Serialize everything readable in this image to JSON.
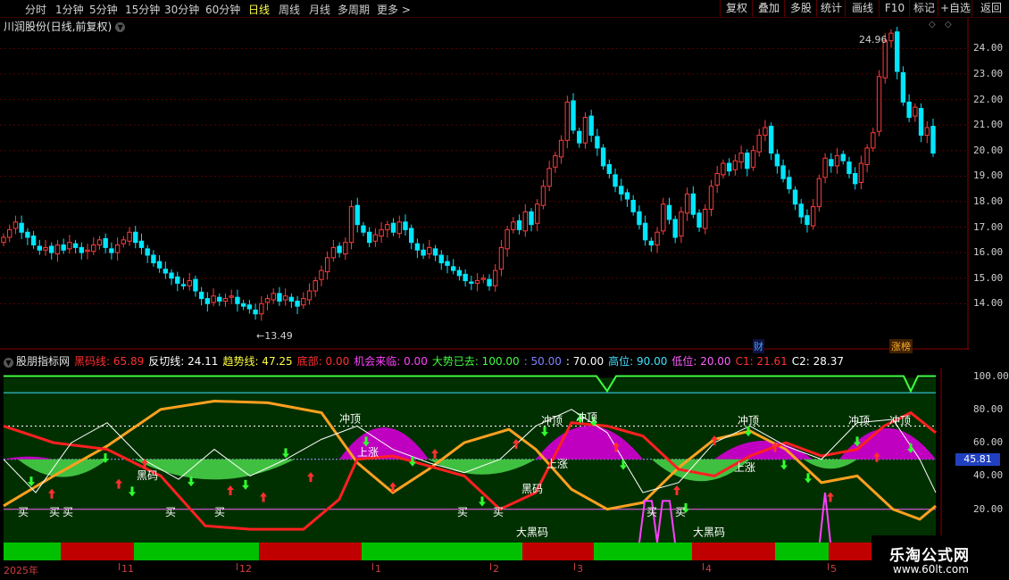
{
  "toolbar": {
    "timeframes": [
      {
        "label": "分时",
        "active": false
      },
      {
        "label": "1分钟",
        "active": false
      },
      {
        "label": "5分钟",
        "active": false
      },
      {
        "label": "15分钟",
        "active": false
      },
      {
        "label": "30分钟",
        "active": false
      },
      {
        "label": "60分钟",
        "active": false
      },
      {
        "label": "日线",
        "active": true
      },
      {
        "label": "周线",
        "active": false
      },
      {
        "label": "月线",
        "active": false
      },
      {
        "label": "多周期",
        "active": false
      },
      {
        "label": "更多 >",
        "active": false
      }
    ],
    "right_buttons": [
      "复权",
      "叠加",
      "多股",
      "统计",
      "画线",
      "F10",
      "标记",
      "+自选",
      "返回"
    ]
  },
  "stock": {
    "title": "川润股份(日线,前复权)",
    "high_label": "24.96",
    "low_label": "13.49",
    "badge_cai": "财",
    "badge_zhang": "涨榜"
  },
  "price_axis": [
    "24.00",
    "23.00",
    "22.00",
    "21.00",
    "20.00",
    "19.00",
    "18.00",
    "17.00",
    "16.00",
    "15.00",
    "14.00"
  ],
  "indicator": {
    "name": "股朋指标网",
    "legend": [
      {
        "text": "黑码线: 65.89",
        "color": "#ff3030"
      },
      {
        "text": "反切线: 24.11",
        "color": "#ffffff"
      },
      {
        "text": "趋势线: 47.25",
        "color": "#ffff40"
      },
      {
        "text": "底部: 0.00",
        "color": "#ff3030"
      },
      {
        "text": "机会来临: 0.00",
        "color": "#ff40ff"
      },
      {
        "text": "大势已去: 100.00",
        "color": "#40ff40"
      },
      {
        "text": ": 50.00",
        "color": "#8080ff"
      },
      {
        "text": ": 70.00",
        "color": "#ffffff"
      },
      {
        "text": "高位: 90.00",
        "color": "#40e0ff"
      },
      {
        "text": "低位: 20.00",
        "color": "#ff60ff"
      },
      {
        "text": "C1: 21.61",
        "color": "#ff3030"
      },
      {
        "text": "C2: 28.37",
        "color": "#ffffff"
      }
    ],
    "axis": [
      "100.00",
      "80.00",
      "60.00",
      "40.00",
      "20.00"
    ],
    "current_value": "45.81",
    "labels": {
      "buy": "买",
      "chongding": "冲顶",
      "shangzhang": "上涨",
      "heima": "黑码",
      "daheima": "大黑码"
    }
  },
  "date_axis": [
    "2025年",
    "11",
    "12",
    "1",
    "2",
    "3",
    "4",
    "5"
  ],
  "watermark": {
    "line1": "乐淘公式网",
    "line2": "www.60lt.com"
  },
  "colors": {
    "up": "#ff3c3c",
    "down": "#00e6ff",
    "bg": "#000000"
  }
}
